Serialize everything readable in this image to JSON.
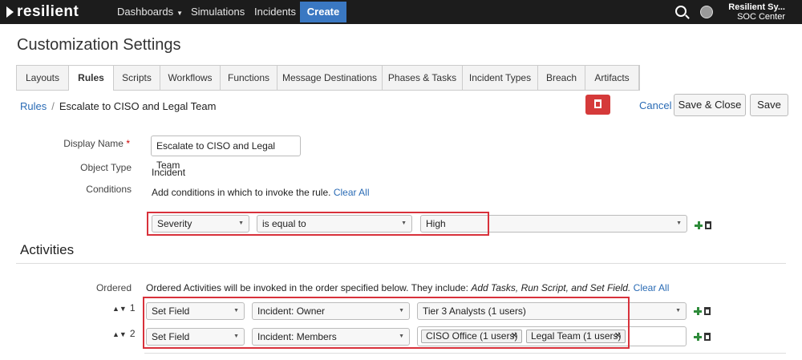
{
  "brand": {
    "name": "resilient"
  },
  "nav": {
    "dashboards": "Dashboards",
    "simulations": "Simulations",
    "incidents": "Incidents",
    "create": "Create"
  },
  "user": {
    "name": "Resilient Sy...",
    "org": "SOC Center"
  },
  "page_title": "Customization Settings",
  "tabs": [
    "Layouts",
    "Rules",
    "Scripts",
    "Workflows",
    "Functions",
    "Message Destinations",
    "Phases & Tasks",
    "Incident Types",
    "Breach",
    "Artifacts"
  ],
  "active_tab": "Rules",
  "breadcrumb": {
    "parent": "Rules",
    "separator": "/",
    "current": "Escalate to CISO and Legal Team"
  },
  "actions": {
    "cancel": "Cancel",
    "save_close": "Save & Close",
    "save": "Save"
  },
  "form": {
    "display_name_label": "Display Name",
    "required_marker": "*",
    "display_name_value": "Escalate to CISO and Legal Team",
    "object_type_label": "Object Type",
    "object_type_value": "Incident",
    "conditions_label": "Conditions",
    "conditions_text": "Add conditions in which to invoke the rule.",
    "clear_all": "Clear All",
    "condition": {
      "field": "Severity",
      "operator": "is equal to",
      "value": "High"
    }
  },
  "activities": {
    "title": "Activities",
    "ordered_label": "Ordered",
    "intro_text": "Ordered Activities will be invoked in the order specified below. They include: ",
    "intro_items": "Add Tasks, Run Script, and Set Field.",
    "clear_all": "Clear All",
    "rows": [
      {
        "number": "1",
        "action": "Set Field",
        "field": "Incident: Owner",
        "value": "Tier 3 Analysts (1 users)"
      },
      {
        "number": "2",
        "action": "Set Field",
        "field": "Incident: Members",
        "tags": [
          "CISO Office (1 users)",
          "Legal Team (1 users)"
        ]
      }
    ]
  },
  "colors": {
    "topbar": "#1c1c1c",
    "create": "#3a78c2",
    "delete": "#d53a3a",
    "highlight": "#d8313b",
    "link": "#2a6bb5",
    "add": "#2e8b3a"
  }
}
